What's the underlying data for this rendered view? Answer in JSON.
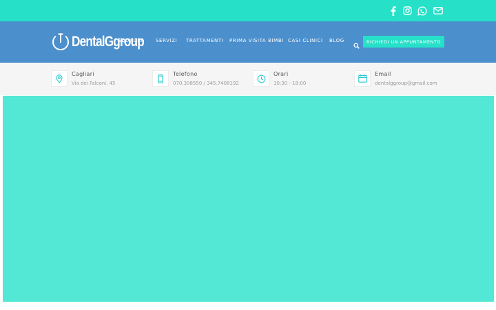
{
  "topbar": {
    "social": [
      "facebook-icon",
      "instagram-icon",
      "whatsapp-icon",
      "envelope-icon"
    ],
    "background": "#26e0c8"
  },
  "header": {
    "logo_text": "DentalGgroup",
    "nav": [
      {
        "label": "SQUADRA"
      },
      {
        "label": "SERVIZI"
      },
      {
        "label": "TRATTAMENTI"
      },
      {
        "label": "PRIMA VISITA BIMBI"
      },
      {
        "label": "CASI CLINICI"
      },
      {
        "label": "BLOG"
      }
    ],
    "cta_label": "RICHIEDI UN APPUNTAMENTO",
    "background": "#4b8fcd"
  },
  "info": [
    {
      "icon": "location-pin-icon",
      "title": "Cagliari",
      "sub": "Via dei Falconi, 45"
    },
    {
      "icon": "smartphone-icon",
      "title": "Telefono",
      "sub": "070.308550 / 345.7408192"
    },
    {
      "icon": "clock-icon",
      "title": "Orari",
      "sub": "10:30 - 18:00"
    },
    {
      "icon": "calendar-icon",
      "title": "Email",
      "sub": "dentalggroup@gmail.com"
    }
  ],
  "hero": {
    "background": "#52e8d5"
  }
}
